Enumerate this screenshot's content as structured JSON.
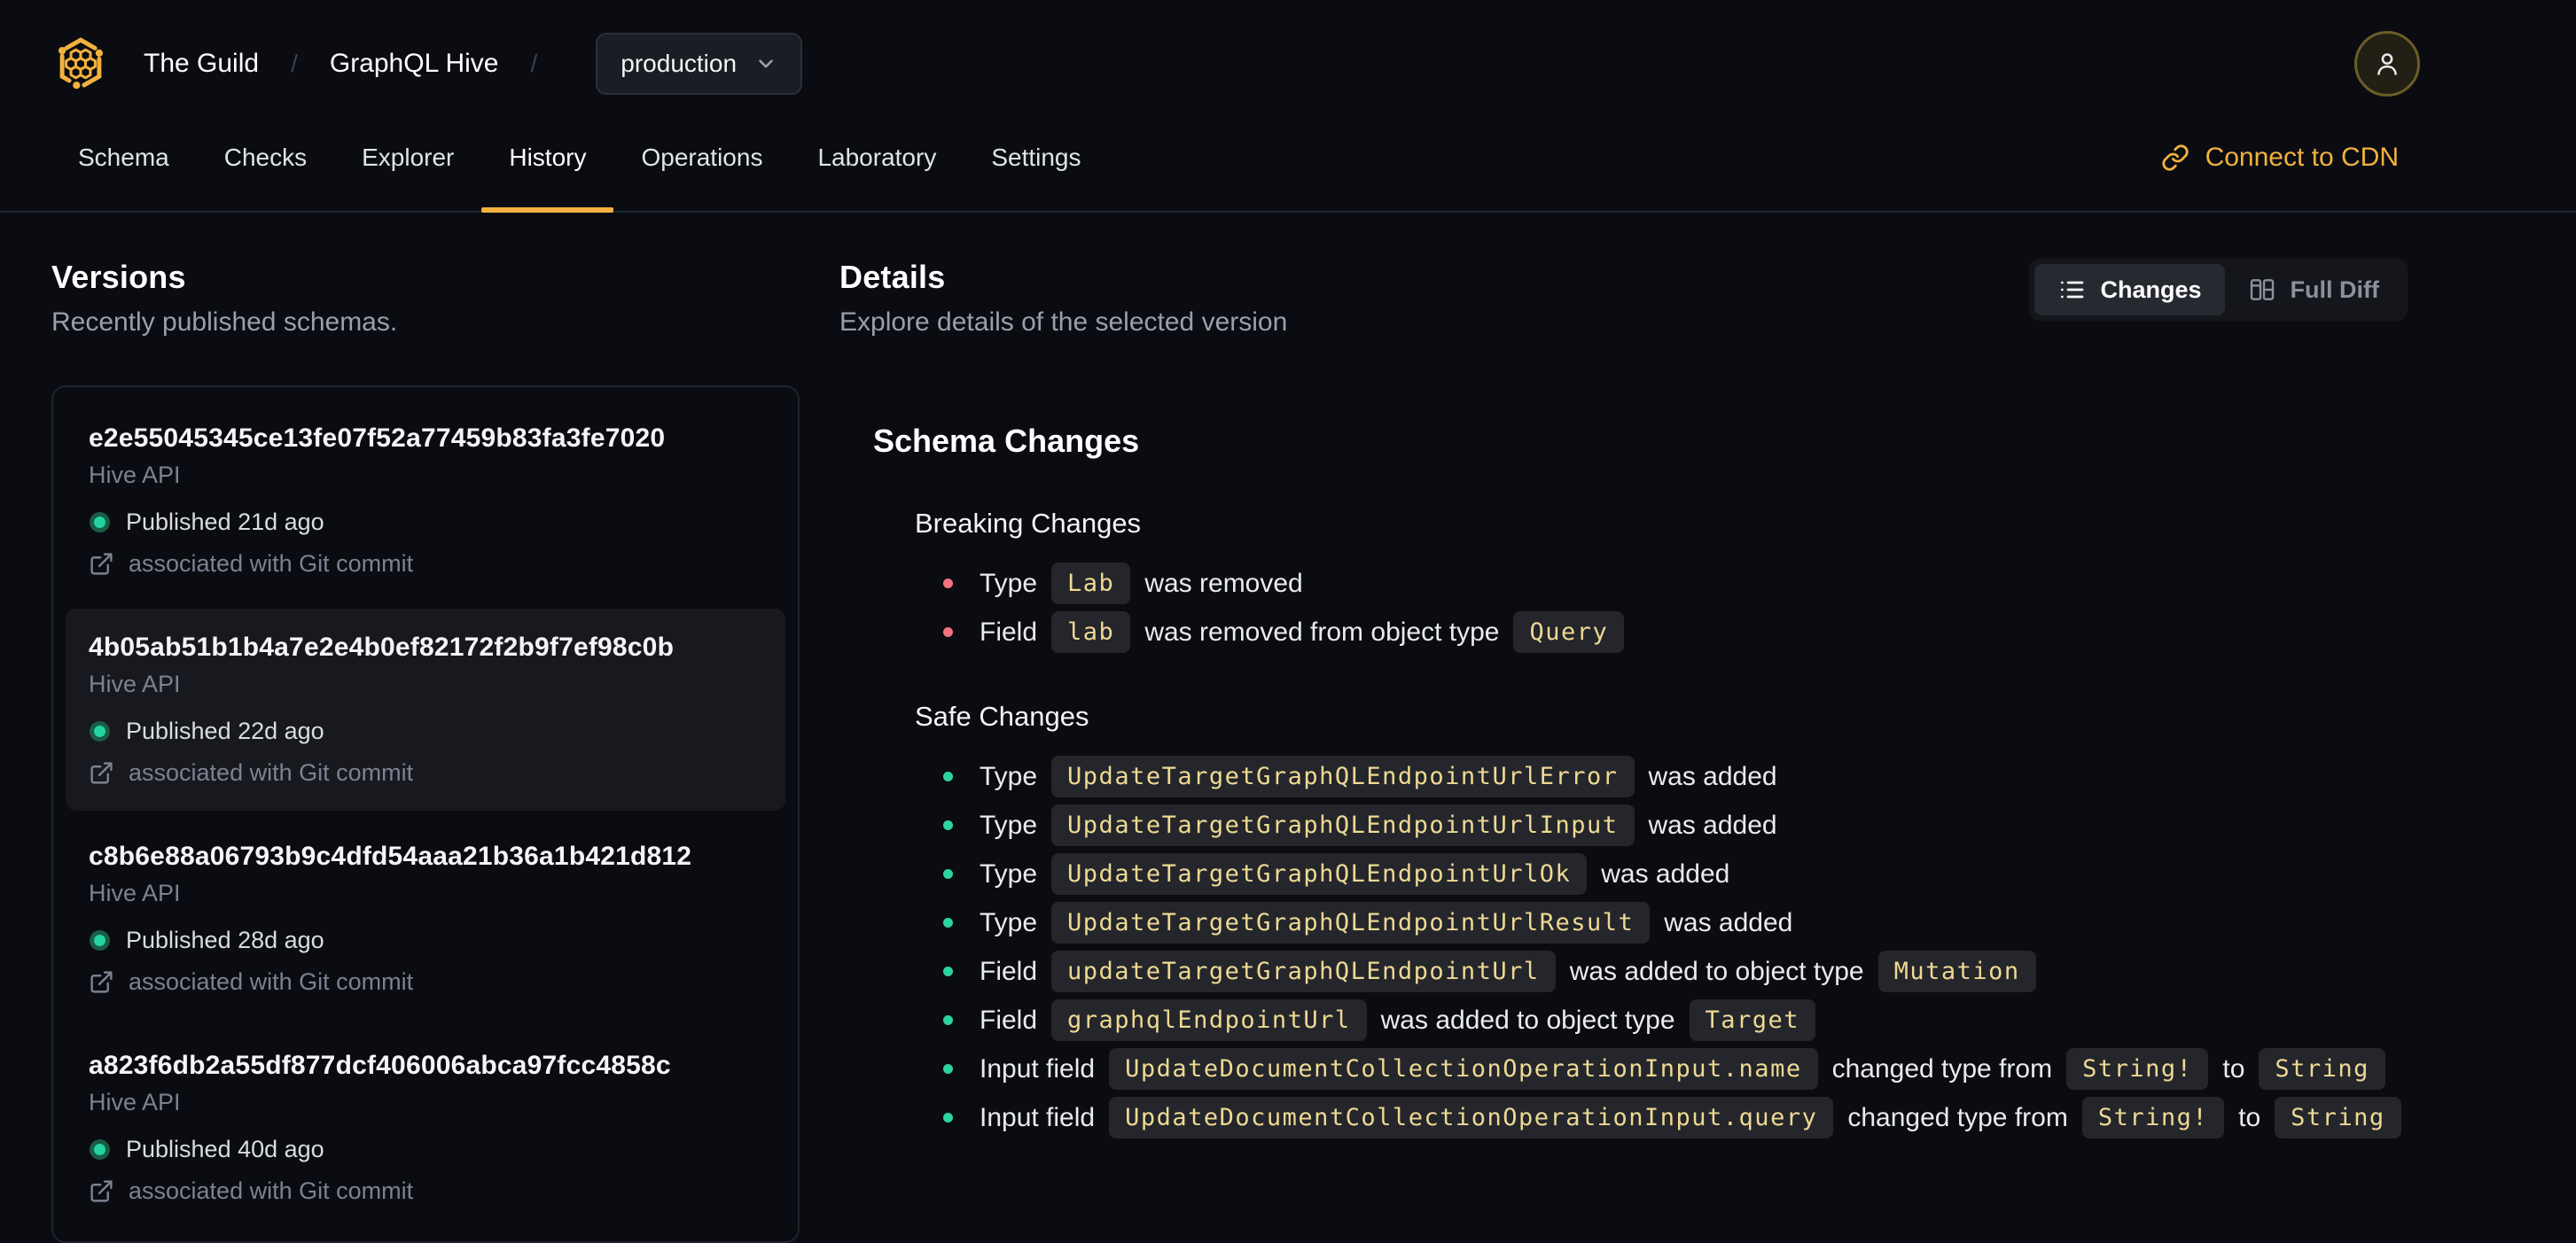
{
  "header": {
    "breadcrumb": {
      "org": "The Guild",
      "separator": "/",
      "project": "GraphQL Hive"
    },
    "target_dropdown": {
      "value": "production"
    },
    "tabs": [
      {
        "label": "Schema",
        "active": false
      },
      {
        "label": "Checks",
        "active": false
      },
      {
        "label": "Explorer",
        "active": false
      },
      {
        "label": "History",
        "active": true
      },
      {
        "label": "Operations",
        "active": false
      },
      {
        "label": "Laboratory",
        "active": false
      },
      {
        "label": "Settings",
        "active": false
      }
    ],
    "connect_cdn_label": "Connect to CDN"
  },
  "versions_panel": {
    "title": "Versions",
    "subtitle": "Recently published schemas.",
    "versions": [
      {
        "hash": "e2e55045345ce13fe07f52a77459b83fa3fe7020",
        "service": "Hive API",
        "published": "Published 21d ago",
        "commit_note": "associated with Git commit",
        "selected": false
      },
      {
        "hash": "4b05ab51b1b4a7e2e4b0ef82172f2b9f7ef98c0b",
        "service": "Hive API",
        "published": "Published 22d ago",
        "commit_note": "associated with Git commit",
        "selected": true
      },
      {
        "hash": "c8b6e88a06793b9c4dfd54aaa21b36a1b421d812",
        "service": "Hive API",
        "published": "Published 28d ago",
        "commit_note": "associated with Git commit",
        "selected": false
      },
      {
        "hash": "a823f6db2a55df877dcf406006abca97fcc4858c",
        "service": "Hive API",
        "published": "Published 40d ago",
        "commit_note": "associated with Git commit",
        "selected": false
      }
    ]
  },
  "details_panel": {
    "title": "Details",
    "subtitle": "Explore details of the selected version",
    "view_toggle": {
      "options": [
        {
          "label": "Changes",
          "icon": "list-icon",
          "active": true
        },
        {
          "label": "Full Diff",
          "icon": "columns-icon",
          "active": false
        }
      ]
    },
    "schema_changes": {
      "heading": "Schema Changes",
      "sections": [
        {
          "title": "Breaking Changes",
          "severity": "breaking",
          "items": [
            [
              [
                "text",
                "Type"
              ],
              [
                "code",
                "Lab"
              ],
              [
                "text",
                "was removed"
              ]
            ],
            [
              [
                "text",
                "Field"
              ],
              [
                "code",
                "lab"
              ],
              [
                "text",
                "was removed from object type"
              ],
              [
                "code",
                "Query"
              ]
            ]
          ]
        },
        {
          "title": "Safe Changes",
          "severity": "safe",
          "items": [
            [
              [
                "text",
                "Type"
              ],
              [
                "code",
                "UpdateTargetGraphQLEndpointUrlError"
              ],
              [
                "text",
                "was added"
              ]
            ],
            [
              [
                "text",
                "Type"
              ],
              [
                "code",
                "UpdateTargetGraphQLEndpointUrlInput"
              ],
              [
                "text",
                "was added"
              ]
            ],
            [
              [
                "text",
                "Type"
              ],
              [
                "code",
                "UpdateTargetGraphQLEndpointUrlOk"
              ],
              [
                "text",
                "was added"
              ]
            ],
            [
              [
                "text",
                "Type"
              ],
              [
                "code",
                "UpdateTargetGraphQLEndpointUrlResult"
              ],
              [
                "text",
                "was added"
              ]
            ],
            [
              [
                "text",
                "Field"
              ],
              [
                "code",
                "updateTargetGraphQLEndpointUrl"
              ],
              [
                "text",
                "was added to object type"
              ],
              [
                "code",
                "Mutation"
              ]
            ],
            [
              [
                "text",
                "Field"
              ],
              [
                "code",
                "graphqlEndpointUrl"
              ],
              [
                "text",
                "was added to object type"
              ],
              [
                "code",
                "Target"
              ]
            ],
            [
              [
                "text",
                "Input field"
              ],
              [
                "code",
                "UpdateDocumentCollectionOperationInput.name"
              ],
              [
                "text",
                "changed type from"
              ],
              [
                "code",
                "String!"
              ],
              [
                "text",
                "to"
              ],
              [
                "code",
                "String"
              ]
            ],
            [
              [
                "text",
                "Input field"
              ],
              [
                "code",
                "UpdateDocumentCollectionOperationInput.query"
              ],
              [
                "text",
                "changed type from"
              ],
              [
                "code",
                "String!"
              ],
              [
                "text",
                "to"
              ],
              [
                "code",
                "String"
              ]
            ]
          ]
        }
      ]
    }
  },
  "colors": {
    "accent": "#f2b13e",
    "code_text": "#eed992",
    "breaking_bullet": "#f4737f",
    "safe_bullet": "#2dd4a0",
    "published_dot": "#24d3a0"
  }
}
